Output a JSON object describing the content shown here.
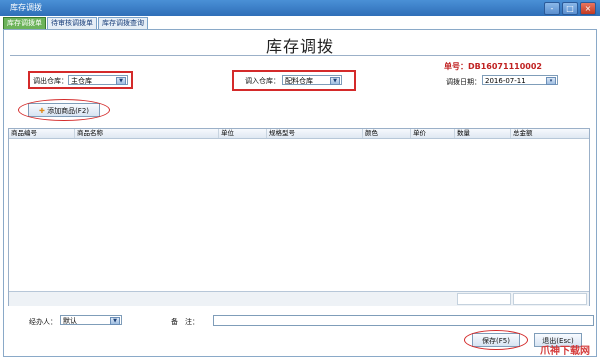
{
  "window": {
    "title": "库存调拨",
    "controls": [
      "-",
      "□",
      "×"
    ]
  },
  "tabs": [
    "库存调拨单",
    "待审核调拨单",
    "库存调拨查询"
  ],
  "heading": "库存调拨",
  "doc_number": "单号：DB16071110002",
  "from_warehouse": {
    "label": "调出仓库：",
    "value": "主仓库"
  },
  "to_warehouse": {
    "label": "调入仓库：",
    "value": "配料仓库"
  },
  "date": {
    "label": "调拨日期：",
    "value": "2016-07-11"
  },
  "add_button": "添加商品(F2)",
  "grid": {
    "columns": [
      "商品编号",
      "商品名称",
      "单位",
      "规格型号",
      "颜色",
      "单价",
      "数量",
      "总金额"
    ]
  },
  "handler": {
    "label": "经办人：",
    "value": "默认"
  },
  "memo": {
    "label": "备　注：",
    "value": ""
  },
  "save_button": "保存(F5)",
  "exit_button": "退出(Esc)",
  "watermark": "爪神下载网"
}
